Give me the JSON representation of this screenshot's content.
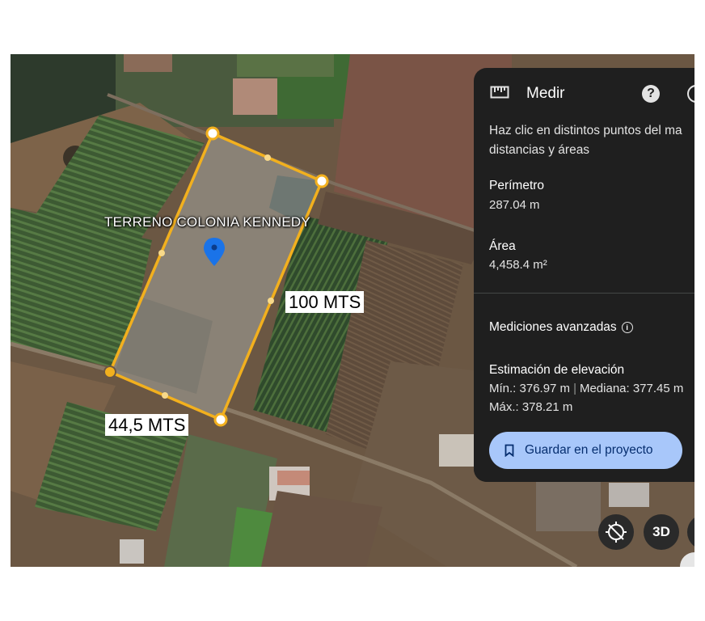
{
  "map": {
    "land_label": "TERRENO COLONIA KENNEDY",
    "dimension_long": "100 MTS",
    "dimension_short": "44,5 MTS",
    "colors": {
      "measure_line": "#f2b01e",
      "pin": "#1a73e8"
    },
    "icons": [
      "location-pin-icon",
      "vertex-handle-icon",
      "midpoint-handle-icon"
    ]
  },
  "measure_panel": {
    "title": "Medir",
    "icons": [
      "ruler-icon",
      "help-icon",
      "close-icon"
    ],
    "instructions_line1": "Haz clic en distintos puntos del ma",
    "instructions_line2": "distancias y áreas",
    "perimeter_label": "Perímetro",
    "perimeter_value": "287.04 m",
    "area_label": "Área",
    "area_value": "4,458.4 m²",
    "advanced_label": "Mediciones avanzadas",
    "info_icon": "info-icon",
    "elevation_label": "Estimación de elevación",
    "elevation_min": "Mín.: 376.97 m",
    "elevation_sep": "|",
    "elevation_median": "Mediana: 377.45 m",
    "elevation_max": "Máx.: 378.21 m",
    "save_label": "Guardar en el proyecto",
    "save_icon": "bookmark-icon",
    "accent_color": "#a8c7fa"
  },
  "map_controls": {
    "compass_icon": "compass-icon",
    "button_3d": "3D"
  }
}
